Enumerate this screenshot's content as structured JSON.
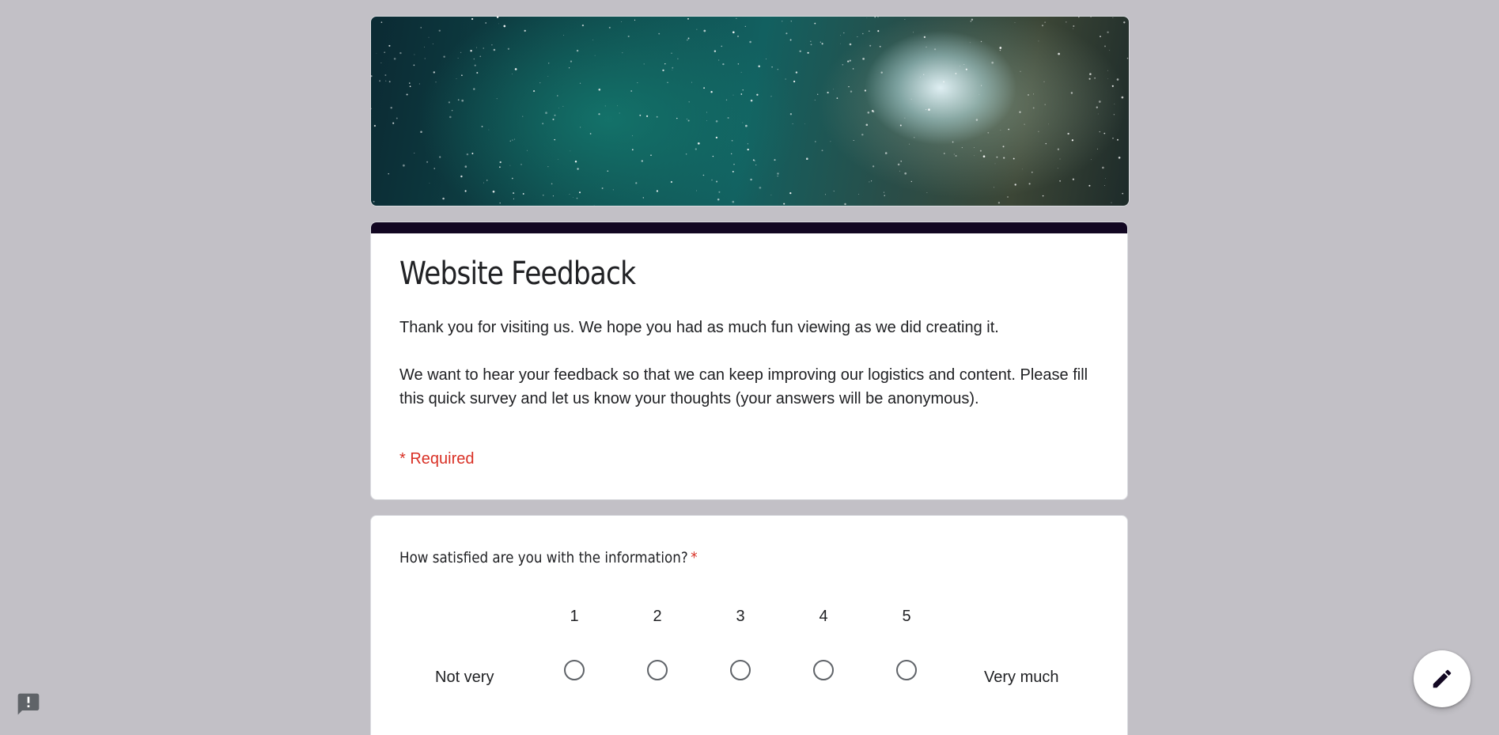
{
  "form": {
    "title": "Website Feedback",
    "description": [
      "Thank you for visiting us. We hope you had as much fun viewing as we did creating it.",
      "We want to hear your feedback so that we can keep improving our logistics and content. Please fill this quick survey and let us know your thoughts (your answers will be anonymous)."
    ],
    "required_note": "* Required"
  },
  "question": {
    "title": "How satisfied are you with the information?",
    "required_mark": "*",
    "low_label": "Not very",
    "high_label": "Very much",
    "options": [
      "1",
      "2",
      "3",
      "4",
      "5"
    ]
  },
  "colors": {
    "header_bar": "#120722",
    "background": "#c2c0c6",
    "required": "#d93025"
  },
  "icons": {
    "report": "report-problem-icon",
    "edit": "pencil-icon"
  }
}
